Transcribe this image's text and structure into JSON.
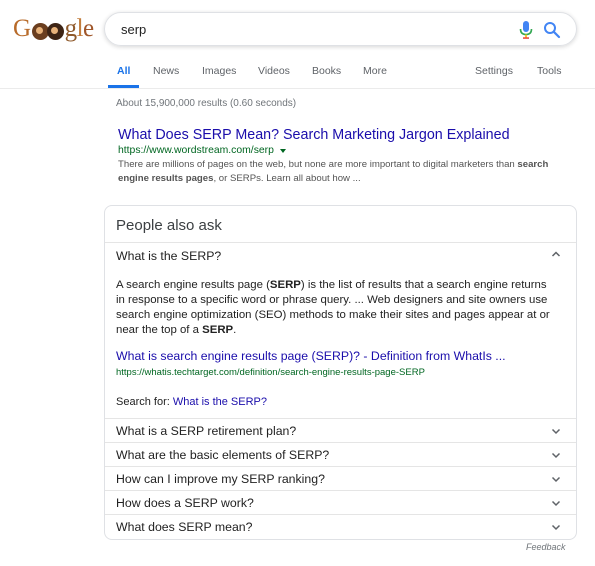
{
  "logo": {
    "text": "Google",
    "icon": "google-doodle-logo"
  },
  "search": {
    "query": "serp",
    "mic_icon": "mic-icon",
    "search_icon": "search-icon"
  },
  "tabs": {
    "items": [
      {
        "label": "All",
        "active": true
      },
      {
        "label": "News"
      },
      {
        "label": "Images"
      },
      {
        "label": "Videos"
      },
      {
        "label": "Books"
      },
      {
        "label": "More"
      }
    ],
    "settings": "Settings",
    "tools": "Tools"
  },
  "result_stats": "About 15,900,000 results (0.60 seconds)",
  "result": {
    "title": "What Does SERP Mean? Search Marketing Jargon Explained",
    "url": "https://www.wordstream.com/serp",
    "snippet_1": "There are millions of pages on the web, but none are more important to digital marketers than ",
    "snippet_b1": "search engine results pages",
    "snippet_2": ", or SERPs. Learn all about how ..."
  },
  "paa": {
    "heading": "People also ask",
    "expanded_question": "What is the SERP?",
    "answer": {
      "p1": "A search engine results page (",
      "b1": "SERP",
      "p2": ") is the list of results that a search engine returns in response to a specific word or phrase query. ... Web designers and site owners use search engine optimization (SEO) methods to make their sites and pages appear at or near the top of a ",
      "b2": "SERP",
      "p3": "."
    },
    "source_title": "What is search engine results page (SERP)? - Definition from WhatIs ...",
    "source_url": "https://whatis.techtarget.com/definition/search-engine-results-page-SERP",
    "search_for_label": "Search for: ",
    "search_for_link": "What is the SERP?",
    "questions": [
      "What is a SERP retirement plan?",
      "What are the basic elements of SERP?",
      "How can I improve my SERP ranking?",
      "How does a SERP work?",
      "What does SERP mean?"
    ]
  },
  "feedback": "Feedback",
  "colors": {
    "link": "#1a0dab",
    "url": "#006621",
    "tab_active": "#1a73e8"
  }
}
